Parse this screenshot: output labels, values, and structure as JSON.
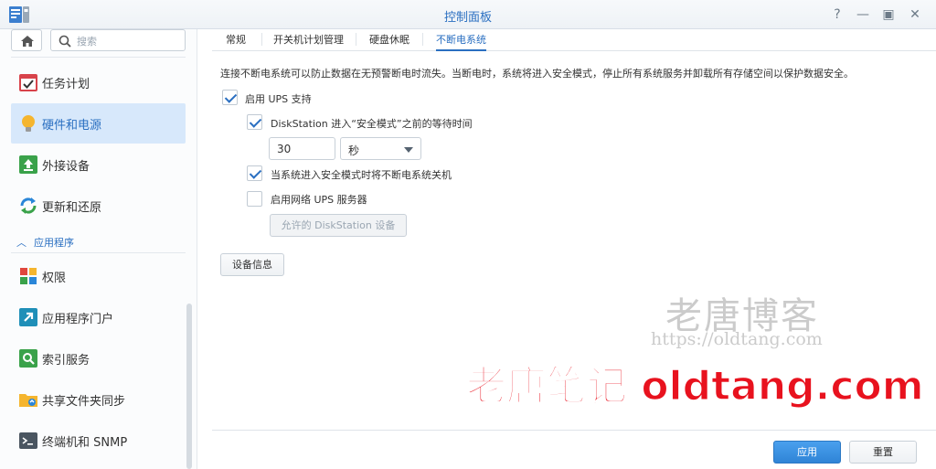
{
  "window": {
    "title": "控制面板",
    "help_glyph": "?",
    "minimize_glyph": "—",
    "maximize_glyph": "▣",
    "close_glyph": "✕"
  },
  "sidebar": {
    "search_placeholder": "搜索",
    "items": [
      {
        "label": "任务计划",
        "icon": "calendar-check-icon",
        "active": false
      },
      {
        "label": "硬件和电源",
        "icon": "lightbulb-icon",
        "active": true
      },
      {
        "label": "外接设备",
        "icon": "upload-icon",
        "active": false
      },
      {
        "label": "更新和还原",
        "icon": "refresh-icon",
        "active": false
      }
    ],
    "section_label": "应用程序",
    "section_items": [
      {
        "label": "权限",
        "icon": "grid-permission-icon"
      },
      {
        "label": "应用程序门户",
        "icon": "portal-arrow-icon"
      },
      {
        "label": "索引服务",
        "icon": "index-search-icon"
      },
      {
        "label": "共享文件夹同步",
        "icon": "folder-sync-icon"
      },
      {
        "label": "终端机和 SNMP",
        "icon": "terminal-icon"
      }
    ]
  },
  "tabs": [
    {
      "label": "常规",
      "active": false
    },
    {
      "label": "开关机计划管理",
      "active": false
    },
    {
      "label": "硬盘休眠",
      "active": false
    },
    {
      "label": "不断电系统",
      "active": true
    }
  ],
  "ups": {
    "description": "连接不断电系统可以防止数据在无预警断电时流失。当断电时，系统将进入安全模式，停止所有系统服务并卸载所有存储空间以保护数据安全。",
    "enable_label": "启用 UPS 支持",
    "enable_checked": true,
    "wait_label": "DiskStation 进入“安全模式”之前的等待时间",
    "wait_checked": true,
    "wait_value": "30",
    "wait_unit": "秒",
    "shutdown_label": "当系统进入安全模式时将不断电系统关机",
    "shutdown_checked": true,
    "network_label": "启用网络 UPS 服务器",
    "network_checked": false,
    "allowed_button": "允许的 DiskStation 设备",
    "device_info_button": "设备信息"
  },
  "footer": {
    "apply": "应用",
    "reset": "重置"
  },
  "watermark": {
    "line1": "老唐博客",
    "line2": "https://oldtang.com",
    "line3": "老唐笔记 oldtang.com"
  },
  "colors": {
    "accent": "#2a6fc1",
    "active_bg": "#d7e8fb",
    "primary_button": "#3a8fe0",
    "watermark_red": "#e8121e"
  }
}
